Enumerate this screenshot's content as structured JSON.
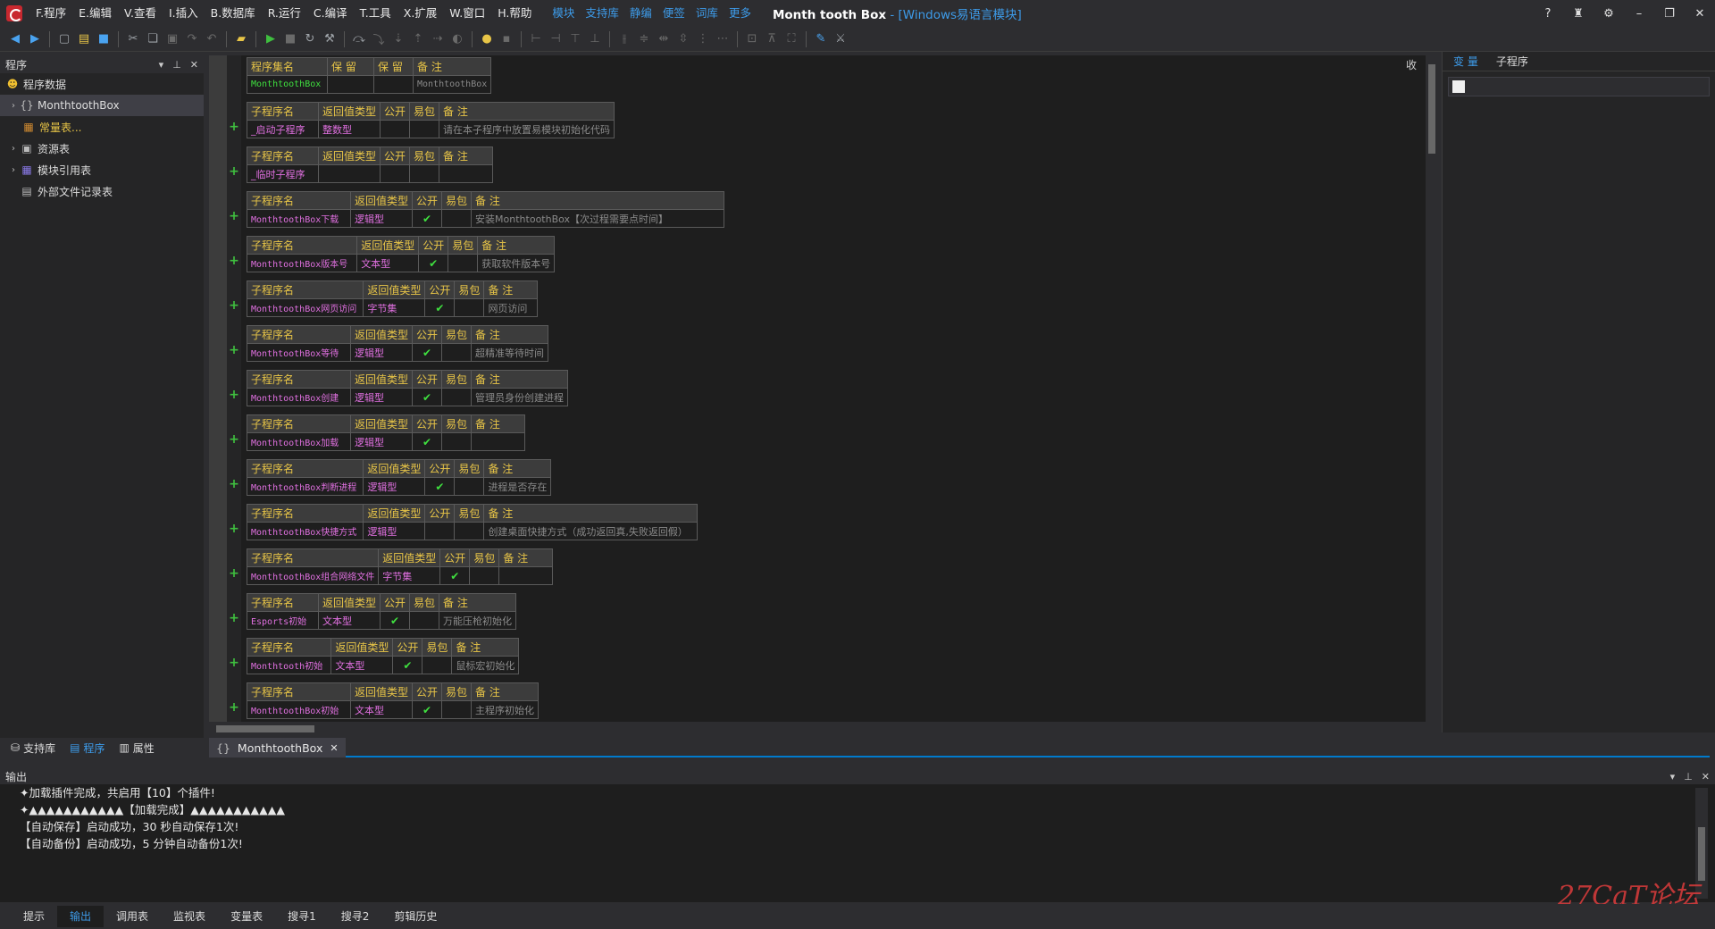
{
  "menu": {
    "items": [
      "F.程序",
      "E.编辑",
      "V.查看",
      "I.插入",
      "B.数据库",
      "R.运行",
      "C.编译",
      "T.工具",
      "X.扩展",
      "W.窗口",
      "H.帮助"
    ],
    "extra": [
      "模块",
      "支持库",
      "静编",
      "便签",
      "词库",
      "更多"
    ]
  },
  "window": {
    "title": "Month tooth Box",
    "subtitle": " - [Windows易语言模块]"
  },
  "left": {
    "title": "程序",
    "items": [
      {
        "label": "程序数据",
        "icon": "smiley-icon"
      },
      {
        "label": "MonthtoothBox",
        "icon": "braces-icon"
      },
      {
        "label": "常量表...",
        "icon": "constants-icon"
      },
      {
        "label": "资源表",
        "icon": "resource-icon"
      },
      {
        "label": "模块引用表",
        "icon": "module-icon"
      },
      {
        "label": "外部文件记录表",
        "icon": "file-icon"
      }
    ],
    "tabs": [
      "支持库",
      "程序",
      "属性"
    ]
  },
  "editor": {
    "collapse_label": "收",
    "assembly": {
      "headers": [
        "程序集名",
        "保 留",
        "保 留",
        "备 注"
      ],
      "name": "MonthtoothBox",
      "note": "MonthtoothBox"
    },
    "sub_headers": [
      "子程序名",
      "返回值类型",
      "公开",
      "易包",
      "备 注"
    ],
    "check_mark": "✔",
    "subs": [
      {
        "name": "_启动子程序",
        "ret": "整数型",
        "public": "",
        "note": "请在本子程序中放置易模块初始化代码",
        "nameMono": false
      },
      {
        "name": "_临时子程序",
        "ret": "",
        "public": "",
        "note": "",
        "nameMono": false
      },
      {
        "name": "MonthtoothBox下载",
        "ret": "逻辑型",
        "public": "✔",
        "note": "安装MonthtoothBox【次过程需要点时间】",
        "nameMono": true
      },
      {
        "name": "MonthtoothBox版本号",
        "ret": "文本型",
        "public": "✔",
        "note": "获取软件版本号",
        "nameMono": true
      },
      {
        "name": "MonthtoothBox网页访问",
        "ret": "字节集",
        "public": "✔",
        "note": "网页访问",
        "nameMono": true
      },
      {
        "name": "MonthtoothBox等待",
        "ret": "逻辑型",
        "public": "✔",
        "note": "超精准等待时间",
        "nameMono": true
      },
      {
        "name": "MonthtoothBox创建",
        "ret": "逻辑型",
        "public": "✔",
        "note": "管理员身份创建进程",
        "nameMono": true
      },
      {
        "name": "MonthtoothBox加载",
        "ret": "逻辑型",
        "public": "✔",
        "note": "",
        "nameMono": true
      },
      {
        "name": "MonthtoothBox判断进程",
        "ret": "逻辑型",
        "public": "✔",
        "note": "进程是否存在",
        "nameMono": true
      },
      {
        "name": "MonthtoothBox快捷方式",
        "ret": "逻辑型",
        "public": "",
        "note": "创建桌面快捷方式（成功返回真,失败返回假）",
        "nameMono": true
      },
      {
        "name": "MonthtoothBox组合网络文件",
        "ret": "字节集",
        "public": "✔",
        "note": "",
        "nameMono": true
      },
      {
        "name": "Esports初始",
        "ret": "文本型",
        "public": "✔",
        "note": "万能压枪初始化",
        "nameMono": true
      },
      {
        "name": "Monthtooth初始",
        "ret": "文本型",
        "public": "✔",
        "note": "鼠标宏初始化",
        "nameMono": true
      },
      {
        "name": "MonthtoothBox初始",
        "ret": "文本型",
        "public": "✔",
        "note": "主程序初始化",
        "nameMono": true
      }
    ]
  },
  "right": {
    "tabs": [
      "变 量",
      "子程序"
    ]
  },
  "doc_tab": {
    "label": "MonthtoothBox",
    "close": "✕"
  },
  "output": {
    "title": "输出",
    "lines": [
      "✦加载插件完成，共启用【10】个插件!",
      "✦▲▲▲▲▲▲▲▲▲▲▲【加载完成】▲▲▲▲▲▲▲▲▲▲▲",
      "【自动保存】启动成功，30 秒自动保存1次!",
      "【自动备份】启动成功，5 分钟自动备份1次!"
    ],
    "watermark": "27CaT论坛"
  },
  "bottom_tabs": [
    "提示",
    "输出",
    "调用表",
    "监视表",
    "变量表",
    "搜寻1",
    "搜寻2",
    "剪辑历史"
  ],
  "colors": {
    "accent": "#3d9be9",
    "header_text": "#e8c547",
    "sub_name": "#e070e0",
    "asm_name": "#3fdf3f"
  }
}
